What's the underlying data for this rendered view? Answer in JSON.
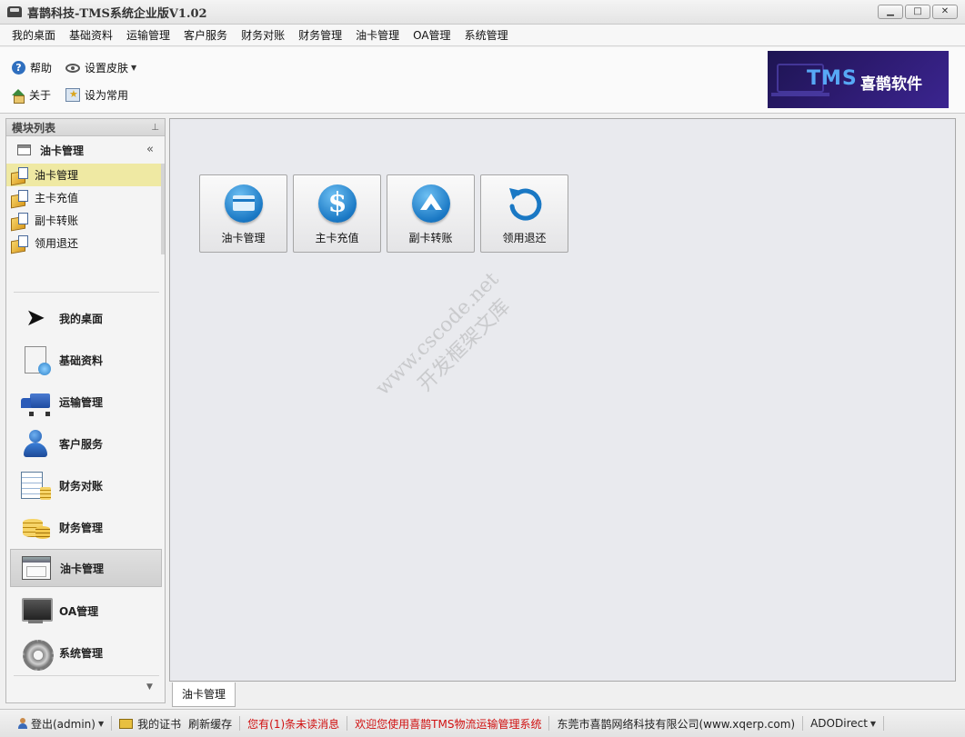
{
  "window": {
    "title": "喜鹊科技-TMS系统企业版V1.02",
    "minimize": "▁",
    "maximize": "□",
    "close": "✕"
  },
  "menubar": {
    "items": [
      "我的桌面",
      "基础资料",
      "运输管理",
      "客户服务",
      "财务对账",
      "财务管理",
      "油卡管理",
      "OA管理",
      "系统管理"
    ]
  },
  "toolbar": {
    "help": "帮助",
    "skin": "设置皮肤",
    "about": "关于",
    "favorite": "设为常用"
  },
  "brand": {
    "tms": "TMS",
    "name": "喜鹊软件"
  },
  "left_panel": {
    "title": "模块列表",
    "group_title": "油卡管理",
    "tree_items": [
      "油卡管理",
      "主卡充值",
      "副卡转账",
      "领用退还"
    ],
    "selected_index": 0,
    "nav": [
      {
        "label": "我的桌面",
        "icon": "cursor-icon"
      },
      {
        "label": "基础资料",
        "icon": "document-icon"
      },
      {
        "label": "运输管理",
        "icon": "truck-icon"
      },
      {
        "label": "客户服务",
        "icon": "person-icon"
      },
      {
        "label": "财务对账",
        "icon": "spreadsheet-icon"
      },
      {
        "label": "财务管理",
        "icon": "coins-icon"
      },
      {
        "label": "油卡管理",
        "icon": "window-icon"
      },
      {
        "label": "OA管理",
        "icon": "monitor-icon"
      },
      {
        "label": "系统管理",
        "icon": "gear-icon"
      }
    ],
    "active_nav": "油卡管理"
  },
  "main": {
    "tiles": [
      {
        "label": "油卡管理",
        "icon": "credit-card-icon"
      },
      {
        "label": "主卡充值",
        "icon": "dollar-icon"
      },
      {
        "label": "副卡转账",
        "icon": "up-arrow-icon"
      },
      {
        "label": "领用退还",
        "icon": "undo-icon"
      }
    ],
    "watermark_line1": "www.cscode.net",
    "watermark_line2": "开发框架文库"
  },
  "tabs": {
    "active": "油卡管理"
  },
  "statusbar": {
    "logout": "登出(admin)",
    "certificate": "我的证书",
    "refresh": "刷新缓存",
    "unread": "您有(1)条未读消息",
    "welcome": "欢迎您使用喜鹊TMS物流运输管理系统",
    "company": "东莞市喜鹊网络科技有限公司(www.xqerp.com)",
    "db": "ADODirect"
  },
  "colors": {
    "brand_bg": "#2c1a6e",
    "brand_tms": "#57a8f5",
    "tile_icon": "#1a78c4",
    "selected_tree": "#efe9a3",
    "status_red": "#d01010"
  }
}
